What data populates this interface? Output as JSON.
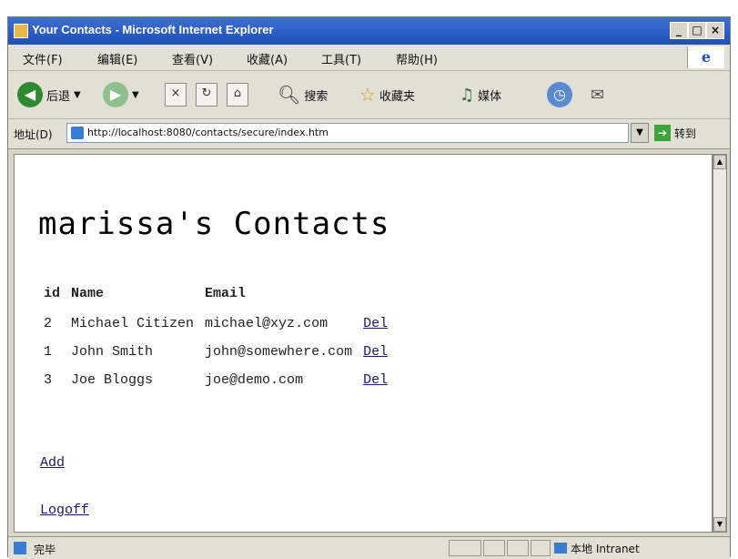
{
  "window": {
    "title": "Your Contacts - Microsoft Internet Explorer",
    "controls": {
      "minimize": "_",
      "maximize": "□",
      "close": "×"
    }
  },
  "menu": [
    "文件(F)",
    "编辑(E)",
    "查看(V)",
    "收藏(A)",
    "工具(T)",
    "帮助(H)"
  ],
  "toolbar": {
    "back": "后退",
    "search": "搜索",
    "favorites": "收藏夹",
    "media": "媒体"
  },
  "address": {
    "label": "地址(D)",
    "url": "http://localhost:8080/contacts/secure/index.htm",
    "go": "转到"
  },
  "page": {
    "title": "marissa's Contacts",
    "columns": {
      "id": "id",
      "name": "Name",
      "email": "Email"
    },
    "contacts": [
      {
        "id": "2",
        "name": "Michael Citizen",
        "email": "michael@xyz.com",
        "action": "Del"
      },
      {
        "id": "1",
        "name": "John Smith",
        "email": "john@somewhere.com",
        "action": "Del"
      },
      {
        "id": "3",
        "name": "Joe Bloggs",
        "email": "joe@demo.com",
        "action": "Del"
      }
    ],
    "add_link": "Add",
    "logoff_link": "Logoff"
  },
  "status": {
    "text": "完毕",
    "zone": "本地 Intranet"
  }
}
